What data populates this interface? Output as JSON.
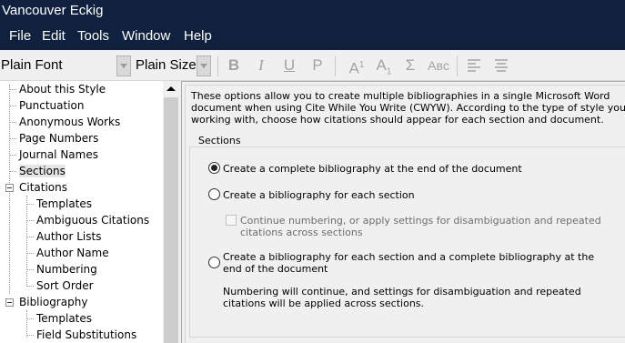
{
  "window": {
    "title": "Vancouver Eckig"
  },
  "menu": [
    "File",
    "Edit",
    "Tools",
    "Window",
    "Help"
  ],
  "toolbar": {
    "font_value": "Plain Font",
    "size_value": "Plain Size",
    "bold": "B",
    "italic": "I",
    "underline": "U",
    "plain": "P",
    "superscript_base": "A",
    "superscript_mark": "1",
    "subscript_base": "A",
    "subscript_mark": "1",
    "symbol": "Σ",
    "smallcaps": "Aʙᴄ"
  },
  "tree": {
    "items": [
      "About this Style",
      "Punctuation",
      "Anonymous Works",
      "Page Numbers",
      "Journal Names",
      "Sections",
      "Citations",
      "Templates",
      "Ambiguous Citations",
      "Author Lists",
      "Author Name",
      "Numbering",
      "Sort Order",
      "Bibliography",
      "Templates",
      "Field Substitutions"
    ]
  },
  "panel": {
    "intro": [
      "These options allow you to create multiple bibliographies in a single Microsoft Word",
      "document when using Cite While You Write (CWYW). According to the type of style you are",
      "working with, choose how citations should appear for each section and document."
    ],
    "group_title": "Sections",
    "option1": "Create a complete bibliography at the end of the document",
    "option2": "Create a bibliography for each section",
    "checkbox_lines": [
      "Continue numbering, or apply settings for disambiguation and repeated",
      "citations across sections"
    ],
    "option3_lines": [
      "Create a bibliography for each section and a complete bibliography at the",
      "end of the document"
    ],
    "note_lines": [
      "Numbering will continue, and settings for disambiguation and repeated",
      "citations will be applied across sections."
    ]
  }
}
